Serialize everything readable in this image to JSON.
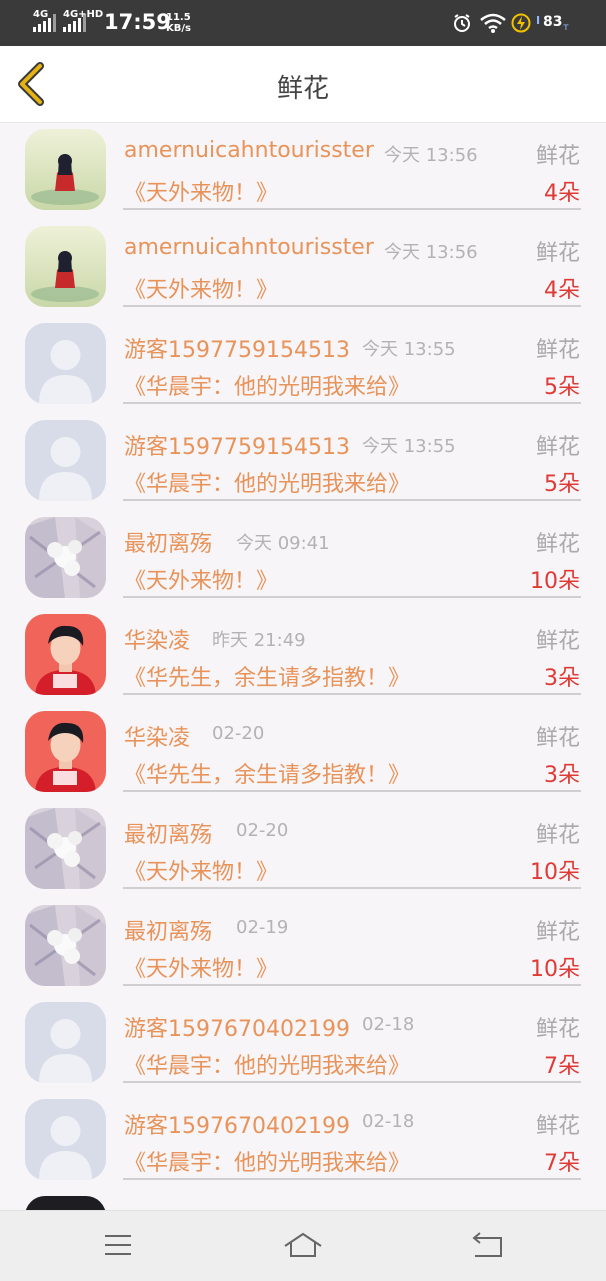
{
  "status_bar": {
    "network1": "4G",
    "network2": "4G+HD",
    "time": "17:59",
    "speed_value": "11.5",
    "speed_unit": "KB/s",
    "battery": "83",
    "icons": [
      "alarm-icon",
      "wifi-icon",
      "charging-icon",
      "battery-icon"
    ]
  },
  "header": {
    "title": "鲜花",
    "back_icon": "chevron-left-icon",
    "accent_color": "#e6b312"
  },
  "colors": {
    "name": "#e8935a",
    "count": "#e03a36",
    "muted": "#b3b3b3"
  },
  "records": [
    {
      "avatar": "girl-landscape",
      "name": "amernuicahntourisster",
      "time": "今天 13:56",
      "type": "鲜花",
      "gift": "《天外来物！》",
      "count": "4朵"
    },
    {
      "avatar": "girl-landscape",
      "name": "amernuicahntourisster",
      "time": "今天 13:56",
      "type": "鲜花",
      "gift": "《天外来物！》",
      "count": "4朵"
    },
    {
      "avatar": "default-person",
      "name": "游客1597759154513",
      "time": "今天 13:55",
      "type": "鲜花",
      "gift": "《华晨宇：他的光明我来给》",
      "count": "5朵"
    },
    {
      "avatar": "default-person",
      "name": "游客1597759154513",
      "time": "今天 13:55",
      "type": "鲜花",
      "gift": "《华晨宇：他的光明我来给》",
      "count": "5朵"
    },
    {
      "avatar": "flowers-hands",
      "name": "最初离殇",
      "time": "今天 09:41",
      "type": "鲜花",
      "gift": "《天外来物！》",
      "count": "10朵"
    },
    {
      "avatar": "boy-red",
      "name": "华染凌",
      "time": "昨天 21:49",
      "type": "鲜花",
      "gift": "《华先生，余生请多指教！》",
      "count": "3朵"
    },
    {
      "avatar": "boy-red",
      "name": "华染凌",
      "time": "02-20",
      "type": "鲜花",
      "gift": "《华先生，余生请多指教！》",
      "count": "3朵"
    },
    {
      "avatar": "flowers-hands",
      "name": "最初离殇",
      "time": "02-20",
      "type": "鲜花",
      "gift": "《天外来物！》",
      "count": "10朵"
    },
    {
      "avatar": "flowers-hands",
      "name": "最初离殇",
      "time": "02-19",
      "type": "鲜花",
      "gift": "《天外来物！》",
      "count": "10朵"
    },
    {
      "avatar": "default-person",
      "name": "游客1597670402199",
      "time": "02-18",
      "type": "鲜花",
      "gift": "《华晨宇：他的光明我来给》",
      "count": "7朵"
    },
    {
      "avatar": "default-person",
      "name": "游客1597670402199",
      "time": "02-18",
      "type": "鲜花",
      "gift": "《华晨宇：他的光明我来给》",
      "count": "7朵"
    }
  ],
  "nav_bar": {
    "icons": [
      "menu-icon",
      "home-icon",
      "back-icon"
    ]
  }
}
